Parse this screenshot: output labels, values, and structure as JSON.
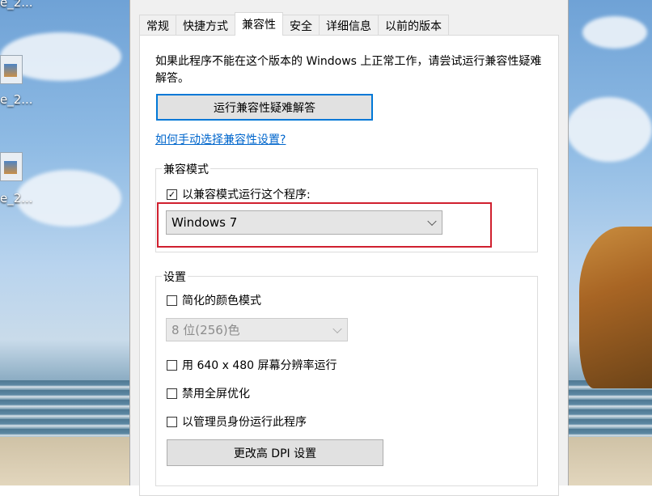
{
  "desktop": {
    "icons": [
      {
        "label": "e_2..."
      },
      {
        "label": "e_2..."
      },
      {
        "label": "e_2..."
      }
    ]
  },
  "dialog": {
    "tabs": [
      {
        "label": "常规"
      },
      {
        "label": "快捷方式"
      },
      {
        "label": "兼容性",
        "active": true
      },
      {
        "label": "安全"
      },
      {
        "label": "详细信息"
      },
      {
        "label": "以前的版本"
      }
    ],
    "description": "如果此程序不能在这个版本的 Windows 上正常工作，请尝试运行兼容性疑难解答。",
    "troubleshoot_button": "运行兼容性疑难解答",
    "manual_link": "如何手动选择兼容性设置?",
    "compat_mode": {
      "title": "兼容模式",
      "checkbox_label": "以兼容模式运行这个程序:",
      "checked": true,
      "check_glyph": "✓",
      "selected_os": "Windows 7"
    },
    "settings": {
      "title": "设置",
      "reduced_color": {
        "label": "简化的颜色模式",
        "checked": false
      },
      "color_select": "8 位(256)色",
      "res640": {
        "label": "用 640 x 480 屏幕分辨率运行",
        "checked": false
      },
      "disable_fullscreen": {
        "label": "禁用全屏优化",
        "checked": false
      },
      "run_admin": {
        "label": "以管理员身份运行此程序",
        "checked": false
      },
      "dpi_button": "更改高 DPI 设置"
    }
  },
  "colors": {
    "highlight_box": "#d0202f",
    "focus_border": "#0078d7",
    "link": "#0066cc"
  }
}
